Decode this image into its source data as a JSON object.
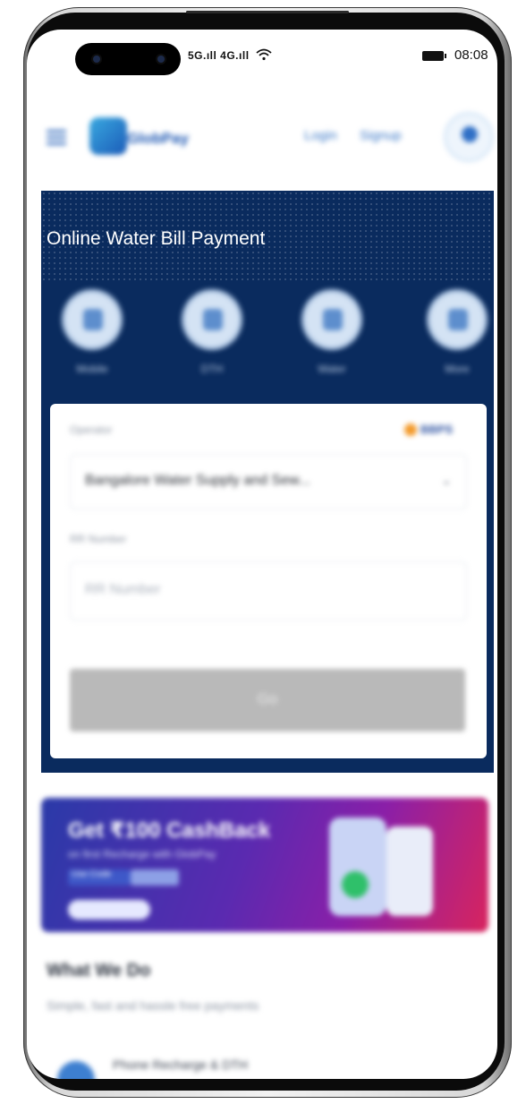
{
  "status_bar": {
    "network": "5G.ıll 4G.ıll",
    "wifi_icon": "wifi-icon",
    "time": "08:08"
  },
  "header": {
    "logo": "GlobPay",
    "login": "Login",
    "signup": "Signup"
  },
  "page_title": "Online Water Bill Payment",
  "tabs": [
    {
      "label": "Mobile"
    },
    {
      "label": "DTH"
    },
    {
      "label": "Water"
    },
    {
      "label": "More"
    }
  ],
  "form": {
    "operator_label": "Operator",
    "bbps": "BBPS",
    "operator_value": "Bangalore Water Supply and Sew...",
    "account_label": "RR Number",
    "account_placeholder": "RR Number",
    "go_button": "Go"
  },
  "promo": {
    "headline": "Get ₹100 CashBack",
    "subtext": "on first Recharge with GlobPay",
    "code_label": "Use Code"
  },
  "what_we_do": {
    "title": "What We Do",
    "subtitle": "Simple, fast and hassle free payments",
    "first_service": "Phone Recharge & DTH"
  },
  "colors": {
    "banner": "#0a2b5e",
    "accent": "#2f8ae0",
    "go_disabled": "#b9b9b9"
  }
}
